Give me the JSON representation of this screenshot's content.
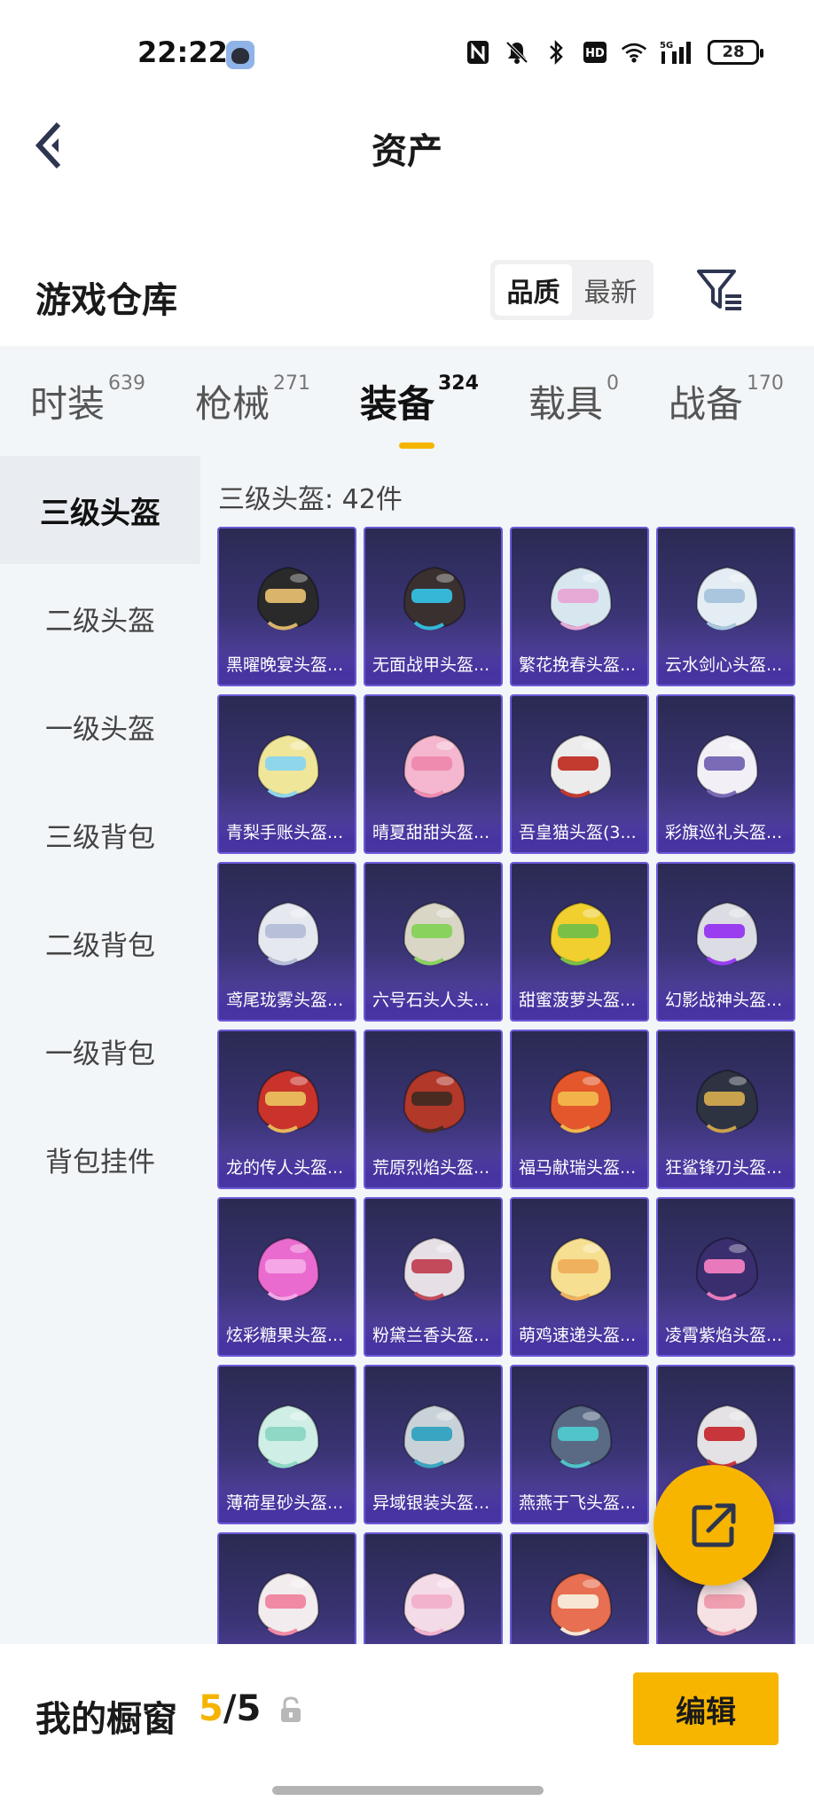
{
  "status_bar": {
    "time": "22:22",
    "icons": [
      "nfc-icon",
      "mute-icon",
      "bluetooth-icon",
      "hd-icon",
      "wifi-icon",
      "signal-5g-icon"
    ],
    "hd_label": "HD",
    "net_label": "5G",
    "battery": "28"
  },
  "header": {
    "title": "资产"
  },
  "section": {
    "title": "游戏仓库",
    "sort_options": [
      "品质",
      "最新"
    ],
    "active_sort": "品质"
  },
  "tabs": [
    {
      "label": "时装",
      "count": "639"
    },
    {
      "label": "枪械",
      "count": "271"
    },
    {
      "label": "装备",
      "count": "324",
      "active": true
    },
    {
      "label": "载具",
      "count": "0"
    },
    {
      "label": "战备",
      "count": "170"
    }
  ],
  "sidebar": {
    "items": [
      "三级头盔",
      "二级头盔",
      "一级头盔",
      "三级背包",
      "二级背包",
      "一级背包",
      "背包挂件"
    ],
    "active": "三级头盔"
  },
  "content": {
    "heading": "三级头盔: 42件",
    "items": [
      {
        "name": "黑曜晚宴头盔...",
        "color": "#2a2a2a",
        "accent": "#d9b46a"
      },
      {
        "name": "无面战甲头盔...",
        "color": "#3a3030",
        "accent": "#35b8d8"
      },
      {
        "name": "繁花挽春头盔...",
        "color": "#d8e6f0",
        "accent": "#e7a9d6"
      },
      {
        "name": "云水剑心头盔...",
        "color": "#e4edf3",
        "accent": "#a9c6de"
      },
      {
        "name": "青梨手账头盔...",
        "color": "#efe69a",
        "accent": "#8fd6ea"
      },
      {
        "name": "晴夏甜甜头盔...",
        "color": "#f4b7cf",
        "accent": "#f08bb0"
      },
      {
        "name": "吾皇猫头盔(3...",
        "color": "#ececec",
        "accent": "#c33a2f"
      },
      {
        "name": "彩旗巡礼头盔...",
        "color": "#f2f0f6",
        "accent": "#7b6bb6"
      },
      {
        "name": "鸢尾珑雾头盔...",
        "color": "#e6e8f0",
        "accent": "#b8bfd8"
      },
      {
        "name": "六号石头人头...",
        "color": "#d9d6c6",
        "accent": "#8ad25e"
      },
      {
        "name": "甜蜜菠萝头盔...",
        "color": "#f0cf2e",
        "accent": "#7bc046"
      },
      {
        "name": "幻影战神头盔...",
        "color": "#dcdde4",
        "accent": "#9a3df0"
      },
      {
        "name": "龙的传人头盔...",
        "color": "#c9332b",
        "accent": "#e8b75a"
      },
      {
        "name": "荒原烈焰头盔...",
        "color": "#b2382a",
        "accent": "#4a2b22"
      },
      {
        "name": "福马献瑞头盔...",
        "color": "#e4572c",
        "accent": "#f2b44a"
      },
      {
        "name": "狂鲨锋刃头盔...",
        "color": "#2e3342",
        "accent": "#c9a24d"
      },
      {
        "name": "炫彩糖果头盔...",
        "color": "#e96bd0",
        "accent": "#f5a6e6"
      },
      {
        "name": "粉黛兰香头盔...",
        "color": "#e7dfe6",
        "accent": "#c24a5b"
      },
      {
        "name": "萌鸡速递头盔...",
        "color": "#f7df92",
        "accent": "#f0b15e"
      },
      {
        "name": "凌霄紫焰头盔...",
        "color": "#3a2e6e",
        "accent": "#e87abc"
      },
      {
        "name": "薄荷星砂头盔...",
        "color": "#cfeee6",
        "accent": "#8fd8c5"
      },
      {
        "name": "异域银装头盔...",
        "color": "#c9d2d8",
        "accent": "#3aa5c3"
      },
      {
        "name": "燕燕于飞头盔...",
        "color": "#5a6a84",
        "accent": "#4fc4c9"
      },
      {
        "name": "",
        "color": "#e4e2e4",
        "accent": "#c8353a"
      },
      {
        "name": "",
        "color": "#f3ecee",
        "accent": "#f08aa4"
      },
      {
        "name": "",
        "color": "#f4dbe8",
        "accent": "#f2b2ce"
      },
      {
        "name": "",
        "color": "#e86f51",
        "accent": "#f7e6d3"
      },
      {
        "name": "",
        "color": "#f6e2e4",
        "accent": "#ef9fb0"
      }
    ]
  },
  "bottom_bar": {
    "label": "我的橱窗",
    "current": "5",
    "sep": "/",
    "total": "5",
    "edit_label": "编辑"
  },
  "colors": {
    "accent": "#f7b500",
    "card_border": "#6c5ad8",
    "background": "#f3f6f9"
  }
}
